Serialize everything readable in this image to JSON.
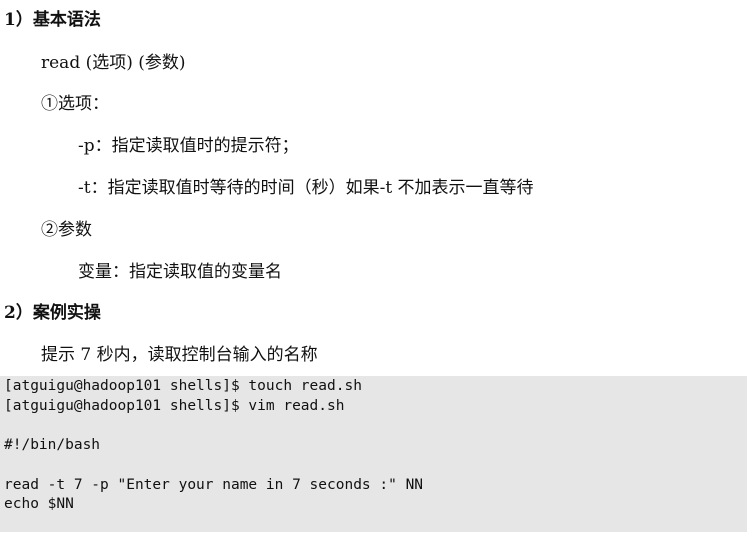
{
  "sections": {
    "basic_syntax_heading": "1）基本语法",
    "syntax_line": "read    (选项)    (参数)",
    "options_label": "①选项：",
    "option_p": "-p：指定读取值时的提示符；",
    "option_t": "-t：指定读取值时等待的时间（秒）如果-t 不加表示一直等待",
    "params_label": "②参数",
    "param_var": "变量：指定读取值的变量名",
    "example_heading": "2）案例实操",
    "example_desc": "提示 7 秒内，读取控制台输入的名称"
  },
  "code": {
    "line1": "[atguigu@hadoop101 shells]$ touch read.sh",
    "line2": "[atguigu@hadoop101 shells]$ vim read.sh",
    "line3": "#!/bin/bash",
    "line4": "read -t 7 -p \"Enter your name in 7 seconds :\" NN",
    "line5": "echo $NN"
  }
}
